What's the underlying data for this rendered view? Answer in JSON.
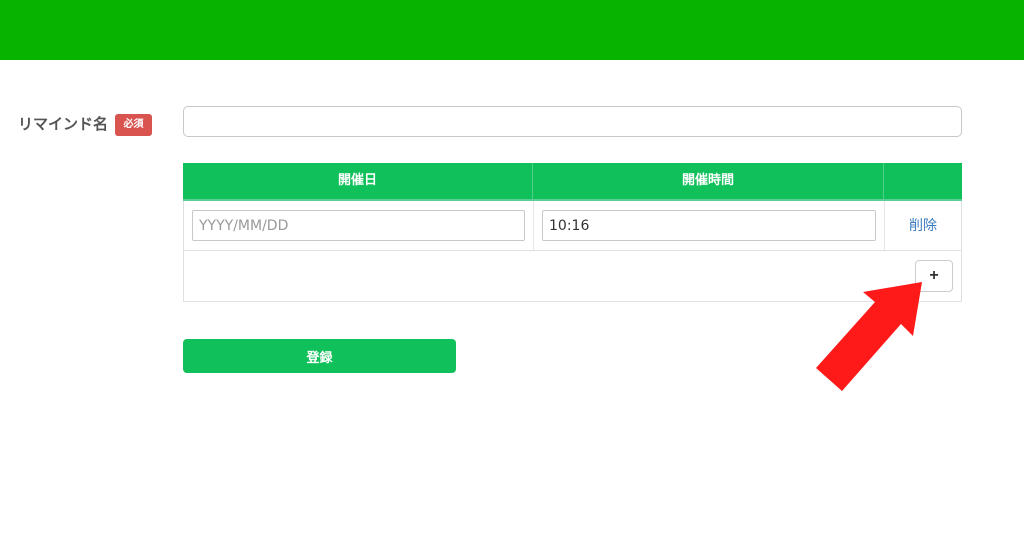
{
  "form": {
    "name_label": "リマインド名",
    "required_badge": "必須",
    "name_value": "",
    "name_placeholder": ""
  },
  "schedule": {
    "headers": [
      "開催日",
      "開催時間",
      ""
    ],
    "rows": [
      {
        "date_value": "",
        "date_placeholder": "YYYY/MM/DD",
        "time_value": "10:16",
        "delete_label": "削除"
      }
    ],
    "add_label": "+"
  },
  "actions": {
    "register_label": "登録"
  },
  "colors": {
    "topbar": "#08b300",
    "primary": "#10c05a",
    "badge": "#d9534f",
    "link": "#3a7bbf",
    "annotation_arrow": "#ff1a1a"
  },
  "annotation": {
    "icon": "arrow-pointing-up-right-icon"
  }
}
